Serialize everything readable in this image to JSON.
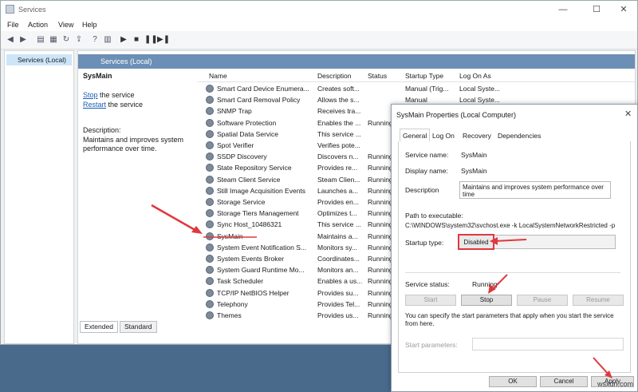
{
  "window": {
    "title": "Services",
    "minimize": "—",
    "maximize": "☐",
    "close": "✕"
  },
  "menu": [
    "File",
    "Action",
    "View",
    "Help"
  ],
  "tree": {
    "item": "Services (Local)"
  },
  "content": {
    "header": "Services (Local)",
    "selected_name": "SysMain",
    "stop_link": "Stop",
    "stop_text": " the service",
    "restart_link": "Restart",
    "restart_text": " the service",
    "description_label": "Description:",
    "description_text": "Maintains and improves system performance over time."
  },
  "columns": {
    "name": "Name",
    "description": "Description",
    "status": "Status",
    "startup": "Startup Type",
    "logon": "Log On As"
  },
  "services": [
    {
      "name": "Smart Card Device Enumera...",
      "desc": "Creates soft...",
      "status": "",
      "startup": "Manual (Trig...",
      "logon": "Local Syste..."
    },
    {
      "name": "Smart Card Removal Policy",
      "desc": "Allows the s...",
      "status": "",
      "startup": "Manual",
      "logon": "Local Syste..."
    },
    {
      "name": "SNMP Trap",
      "desc": "Receives tra...",
      "status": "",
      "startup": "",
      "logon": ""
    },
    {
      "name": "Software Protection",
      "desc": "Enables the ...",
      "status": "Running",
      "startup": "",
      "logon": ""
    },
    {
      "name": "Spatial Data Service",
      "desc": "This service ...",
      "status": "",
      "startup": "",
      "logon": ""
    },
    {
      "name": "Spot Verifier",
      "desc": "Verifies pote...",
      "status": "",
      "startup": "",
      "logon": ""
    },
    {
      "name": "SSDP Discovery",
      "desc": "Discovers n...",
      "status": "Running",
      "startup": "",
      "logon": ""
    },
    {
      "name": "State Repository Service",
      "desc": "Provides re...",
      "status": "Running",
      "startup": "",
      "logon": ""
    },
    {
      "name": "Steam Client Service",
      "desc": "Steam Clien...",
      "status": "Running",
      "startup": "",
      "logon": ""
    },
    {
      "name": "Still Image Acquisition Events",
      "desc": "Launches a...",
      "status": "Running",
      "startup": "",
      "logon": ""
    },
    {
      "name": "Storage Service",
      "desc": "Provides en...",
      "status": "Running",
      "startup": "",
      "logon": ""
    },
    {
      "name": "Storage Tiers Management",
      "desc": "Optimizes t...",
      "status": "Running",
      "startup": "",
      "logon": ""
    },
    {
      "name": "Sync Host_10486321",
      "desc": "This service ...",
      "status": "Running",
      "startup": "",
      "logon": ""
    },
    {
      "name": "SysMain",
      "desc": "Maintains a...",
      "status": "Running",
      "startup": "",
      "logon": ""
    },
    {
      "name": "System Event Notification S...",
      "desc": "Monitors sy...",
      "status": "Running",
      "startup": "",
      "logon": ""
    },
    {
      "name": "System Events Broker",
      "desc": "Coordinates...",
      "status": "Running",
      "startup": "",
      "logon": ""
    },
    {
      "name": "System Guard Runtime Mo...",
      "desc": "Monitors an...",
      "status": "Running",
      "startup": "",
      "logon": ""
    },
    {
      "name": "Task Scheduler",
      "desc": "Enables a us...",
      "status": "Running",
      "startup": "",
      "logon": ""
    },
    {
      "name": "TCP/IP NetBIOS Helper",
      "desc": "Provides su...",
      "status": "Running",
      "startup": "",
      "logon": ""
    },
    {
      "name": "Telephony",
      "desc": "Provides Tel...",
      "status": "Running",
      "startup": "",
      "logon": ""
    },
    {
      "name": "Themes",
      "desc": "Provides us...",
      "status": "Running",
      "startup": "",
      "logon": ""
    }
  ],
  "bottom_tabs": [
    "Extended",
    "Standard"
  ],
  "dialog": {
    "title": "SysMain Properties (Local Computer)",
    "tabs": [
      "General",
      "Log On",
      "Recovery",
      "Dependencies"
    ],
    "service_name_label": "Service name:",
    "service_name": "SysMain",
    "display_name_label": "Display name:",
    "display_name": "SysMain",
    "description_label": "Description",
    "description": "Maintains and improves system performance over time",
    "path_label": "Path to executable:",
    "path": "C:\\WINDOWS\\system32\\svchost.exe -k LocalSystemNetworkRestricted -p",
    "startup_label": "Startup type:",
    "startup_value": "Disabled",
    "status_label": "Service status:",
    "status_value": "Running",
    "btn_start": "Start",
    "btn_stop": "Stop",
    "btn_pause": "Pause",
    "btn_resume": "Resume",
    "params_note": "You can specify the start parameters that apply when you start the service from here.",
    "params_label": "Start parameters:",
    "ok": "OK",
    "cancel": "Cancel",
    "apply": "Apply"
  },
  "watermark": "wsxdn.com",
  "colors": {
    "accent": "#6b8fb5",
    "highlight": "#e0383e"
  }
}
